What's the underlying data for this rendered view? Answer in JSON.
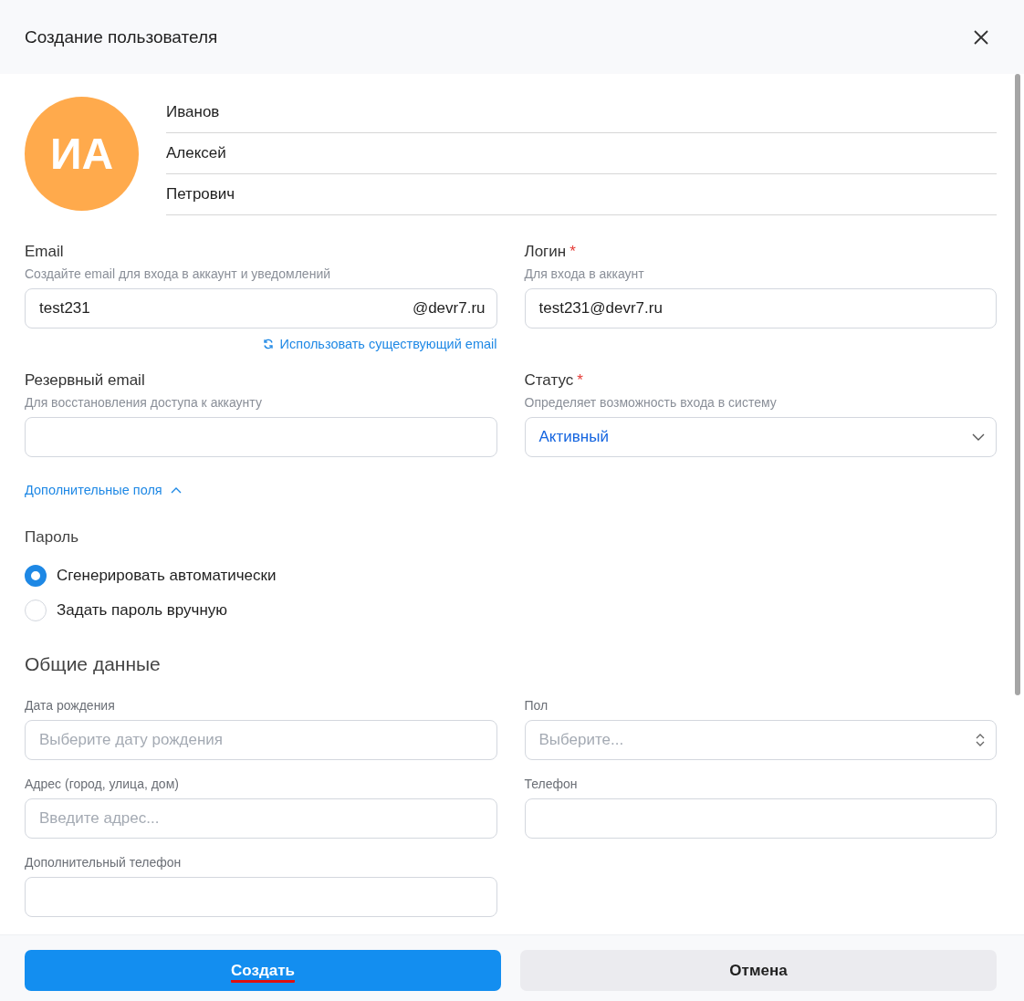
{
  "dialog": {
    "title": "Создание пользователя"
  },
  "avatar": {
    "initials": "ИА"
  },
  "name_fields": [
    {
      "value": "Иванов"
    },
    {
      "value": "Алексей"
    },
    {
      "value": "Петрович"
    }
  ],
  "account_fields": [
    {
      "label": "Email",
      "hint": "Создайте email для входа в аккаунт и уведомлений",
      "value": "test231",
      "suffix": "@devr7.ru",
      "link": "Использовать существующий email",
      "kind": "text"
    },
    {
      "label": "Логин",
      "required_mark": "*",
      "hint": "Для входа в аккаунт",
      "value": "test231@devr7.ru",
      "kind": "text"
    },
    {
      "label": "Резервный email",
      "hint": "Для восстановления доступа к аккаунту",
      "kind": "text"
    },
    {
      "label": "Статус",
      "required_mark": "*",
      "hint": "Определяет возможность входа в систему",
      "value": "Активный",
      "kind": "select"
    }
  ],
  "extra_toggle": {
    "label": "Дополнительные поля",
    "expanded": true
  },
  "password": {
    "label": "Пароль",
    "options": [
      {
        "label": "Сгенерировать автоматически",
        "selected": true
      },
      {
        "label": "Задать пароль вручную",
        "selected": false
      }
    ]
  },
  "general": {
    "title": "Общие данные",
    "fields": [
      {
        "label": "Дата рождения",
        "placeholder": "Выберите дату рождения",
        "kind": "text"
      },
      {
        "label": "Пол",
        "placeholder": "Выберите...",
        "kind": "select"
      },
      {
        "label": "Адрес (город, улица, дом)",
        "placeholder": "Введите адрес...",
        "kind": "text"
      },
      {
        "label": "Телефон",
        "kind": "text"
      },
      {
        "label": "Дополнительный телефон",
        "kind": "text"
      }
    ]
  },
  "buttons": [
    {
      "label": "Создать",
      "kind": "primary"
    },
    {
      "label": "Отмена",
      "kind": "secondary"
    }
  ]
}
